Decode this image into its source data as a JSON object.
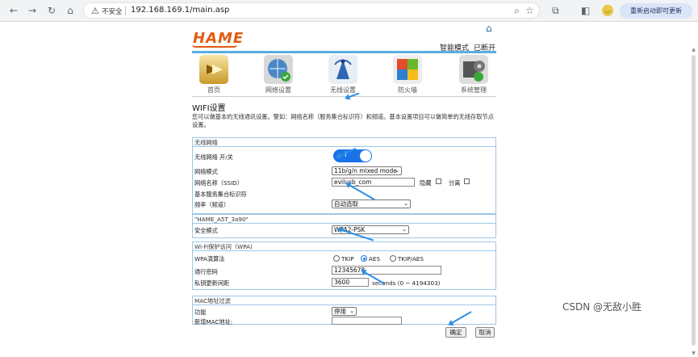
{
  "browser": {
    "insecure_label": "不安全",
    "url": "192.168.169.1/main.asp",
    "update_button": "重新启动即可更新"
  },
  "header": {
    "logo": "HAME",
    "mode": "智能模式",
    "status": "已断开"
  },
  "menu": [
    {
      "label": "首页",
      "icon": "home-arrow-icon"
    },
    {
      "label": "网络设置",
      "icon": "globe-check-icon"
    },
    {
      "label": "无线设置",
      "icon": "antenna-icon"
    },
    {
      "label": "防火墙",
      "icon": "shield-flag-icon"
    },
    {
      "label": "系统管理",
      "icon": "gear-icon"
    }
  ],
  "page": {
    "title": "WIFI设置",
    "description": "您可以做基本的无线通讯设置。譬如：网络名称（服务集合标识符）和频道。基本设置项目可以做简单的无线存取节点设置。"
  },
  "wireless": {
    "section_title": "无线网络",
    "switch_label": "无线网络 开/关",
    "switch_state": "I",
    "mode_label": "网络模式",
    "mode_value": "11b/g/n mixed mode",
    "ssid_label": "网络名称（SSID）",
    "ssid_value": "evilusb_com",
    "hide_label": "隐藏",
    "isolate_label": "分离",
    "bssid_label": "基本服务集合标识符",
    "channel_label": "频率（频道）",
    "channel_value": "自动选取"
  },
  "security": {
    "section_title": "\"HAME_A5T_3a90\"",
    "mode_label": "安全模式",
    "mode_value": "WPA2-PSK"
  },
  "wpa": {
    "section_title": "Wi-Fi保护访问（WPA)",
    "algo_label": "WPA演算法",
    "algo_options": [
      "TKIP",
      "AES",
      "TKIP/AES"
    ],
    "algo_selected": "AES",
    "pass_label": "通行密码",
    "pass_value": "12345678",
    "rekey_label": "私钥更新间距",
    "rekey_value": "3600",
    "rekey_unit": "seconds  (0 ~ 4194303)"
  },
  "mac": {
    "section_title": "MAC地址过滤",
    "func_label": "功能",
    "func_value": "停用",
    "add_label": "新增MAC地址:",
    "add_value": ""
  },
  "actions": {
    "ok": "确定",
    "cancel": "取消"
  },
  "watermark": "CSDN @无敌小胜"
}
